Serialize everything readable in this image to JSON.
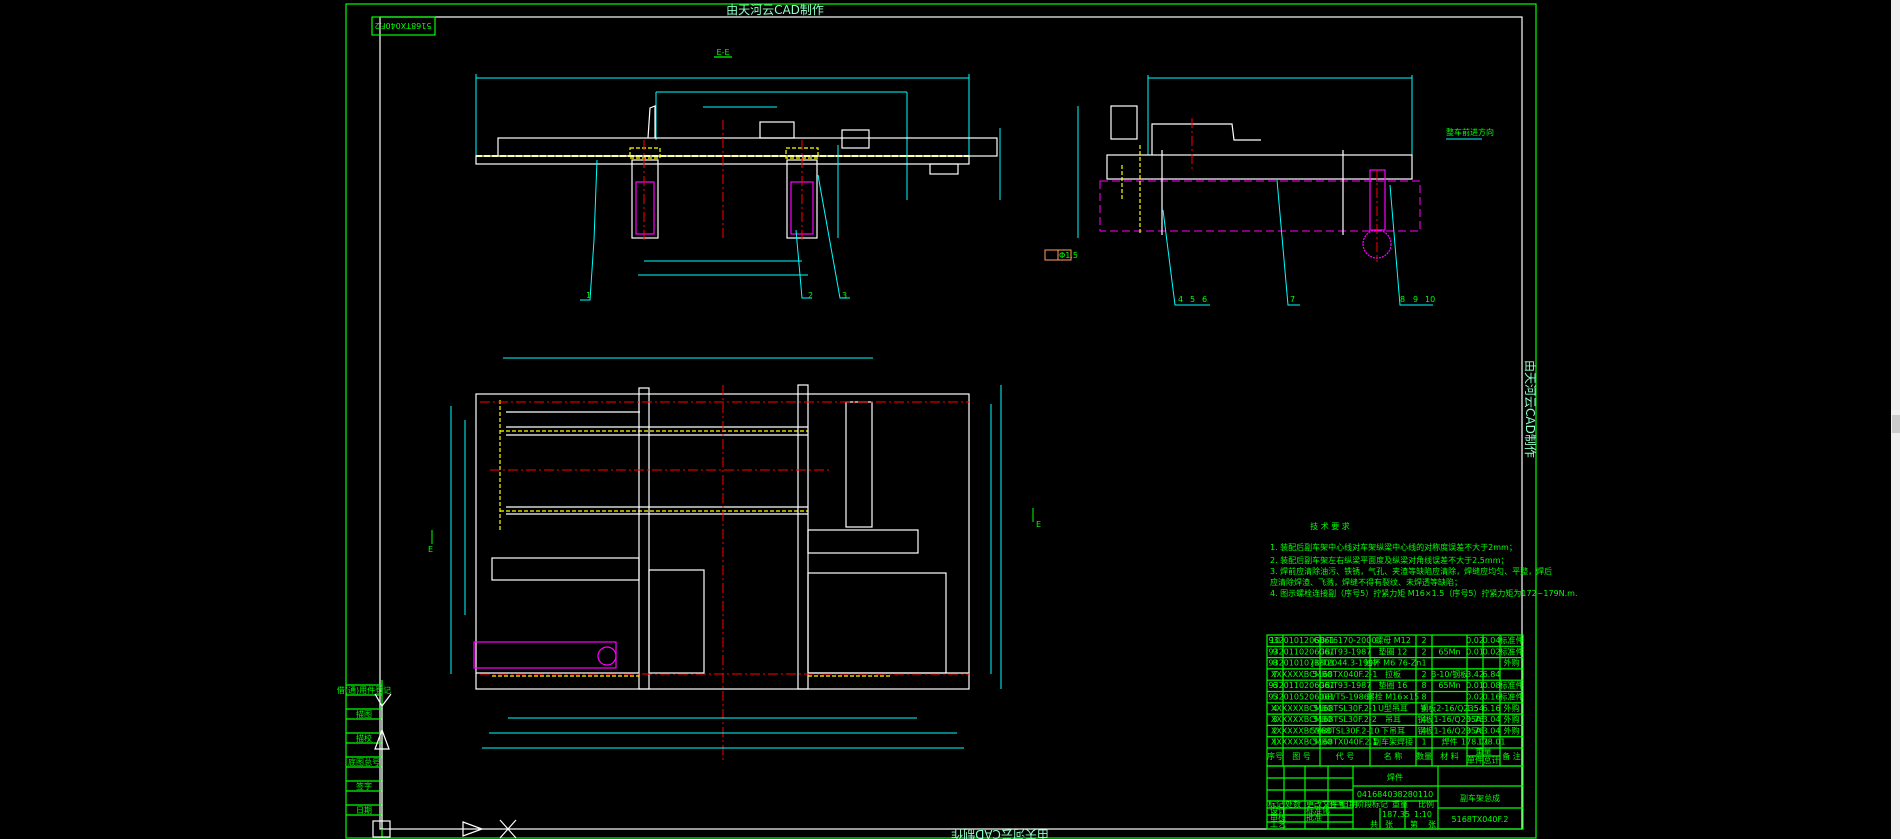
{
  "watermark": {
    "top": "由天河云CAD制作",
    "right": "由天河云CAD制作",
    "bottom": "由天河云CAD制作"
  },
  "corner_code": "5168TX040F.2",
  "section_label": "E-E",
  "section_marker": "E",
  "direction_label": "整车前进方向",
  "front_view_items": [
    "1",
    "2",
    "3"
  ],
  "side_view_items": [
    "4",
    "5",
    "6",
    "7",
    "8",
    "9",
    "10"
  ],
  "weld_symbol": "Φ1.5",
  "tech_requirements": {
    "title": "技 术 要 求",
    "lines": [
      "1. 装配后副车架中心线对车架纵梁中心线的对称度误差不大于2mm；",
      "2. 装配后副车架左右纵梁平面度及纵梁对角线误差不大于2.5mm；",
      "3. 焊前应清除油污、铁锈，气孔、夹渣等缺陷应清除，焊缝应均匀、平整，焊后",
      "   应清除焊渣、飞溅，焊缝不得有裂纹、未焊透等缺陷；",
      "4. 图示螺栓连接副（序号5）拧紧力矩 M16×1.5（序号5）拧紧力矩为172~179N.m."
    ]
  },
  "bom": {
    "header": [
      "序号",
      "图 号",
      "代 号",
      "名 称",
      "数量",
      "材 料",
      "单件",
      "总计",
      "备 注"
    ],
    "weight_label": "重量",
    "rows": [
      [
        "10",
        "9320101206061",
        "GB/T6170-2000",
        "螺母 M12",
        "2",
        "",
        "0.02",
        "0.04",
        "标准件"
      ],
      [
        "9",
        "9320110206061",
        "GB/T93-1987",
        "垫圈 12",
        "2",
        "65Mn",
        "0.01",
        "0.02",
        "标准件"
      ],
      [
        "8",
        "9320101071301",
        "JB/T2044.3-1997",
        "油杯 M6 76-Zn",
        "1",
        "",
        "",
        "",
        "外购"
      ],
      [
        "7",
        "XXXXXXBCMB0",
        "5168TX040F.2-1",
        "拉板",
        "2",
        "B-10/钢板",
        "3.42",
        "6.84",
        ""
      ],
      [
        "6",
        "9320110206061",
        "GB/T93-1987",
        "垫圈 16",
        "8",
        "65Mn",
        "0.01",
        "0.08",
        "标准件"
      ],
      [
        "5",
        "9320105206061",
        "GB/T5-1986",
        "螺栓 M16×15",
        "8",
        "",
        "0.02",
        "0.16",
        "标准件"
      ],
      [
        "4",
        "XXXXXXBCMB0",
        "5168TSL30F.2-1",
        "U型吊耳",
        "4",
        "钢板2-16/Q235",
        "1.54",
        "6.16",
        "外购"
      ],
      [
        "3",
        "XXXXXXBCMB0",
        "5168TSL30F.2-2",
        "吊耳",
        "4",
        "钢板1-16/Q235A",
        "0.76",
        "3.04",
        "外购"
      ],
      [
        "2",
        "XXXXXXBCMB0",
        "5168TSL30F.2-10",
        "下吊耳",
        "4",
        "钢板1-16/Q235A",
        "0.76",
        "3.04",
        "外购"
      ],
      [
        "1",
        "XXXXXXBCMB0",
        "5168TX040F.2.1",
        "副车架焊接",
        "1",
        "焊件",
        "178.01",
        "178.01",
        ""
      ]
    ]
  },
  "title_block": {
    "material": "焊件",
    "code": "041684038280110",
    "name": "副车架总成",
    "drawing_no": "5168TX040F.2",
    "labels": [
      "标记",
      "处数",
      "更改文件号",
      "签字",
      "日期",
      "设计",
      "审核",
      "工艺",
      "标准化",
      "批准",
      "阶段标记",
      "重量",
      "比例",
      "共",
      "张",
      "第",
      "张"
    ],
    "scale": "1:10",
    "weight": "187.35"
  },
  "stamp_column": [
    "借(通)用件登记",
    "描图",
    "描校",
    "底图总号",
    "签字",
    "日期"
  ],
  "colors": {
    "frame": "#00ff00",
    "outline": "#ffffff",
    "dimension": "#00ffff",
    "centerline": "#ff0000",
    "hidden": "#ffff00",
    "purchased": "#ff00ff"
  }
}
